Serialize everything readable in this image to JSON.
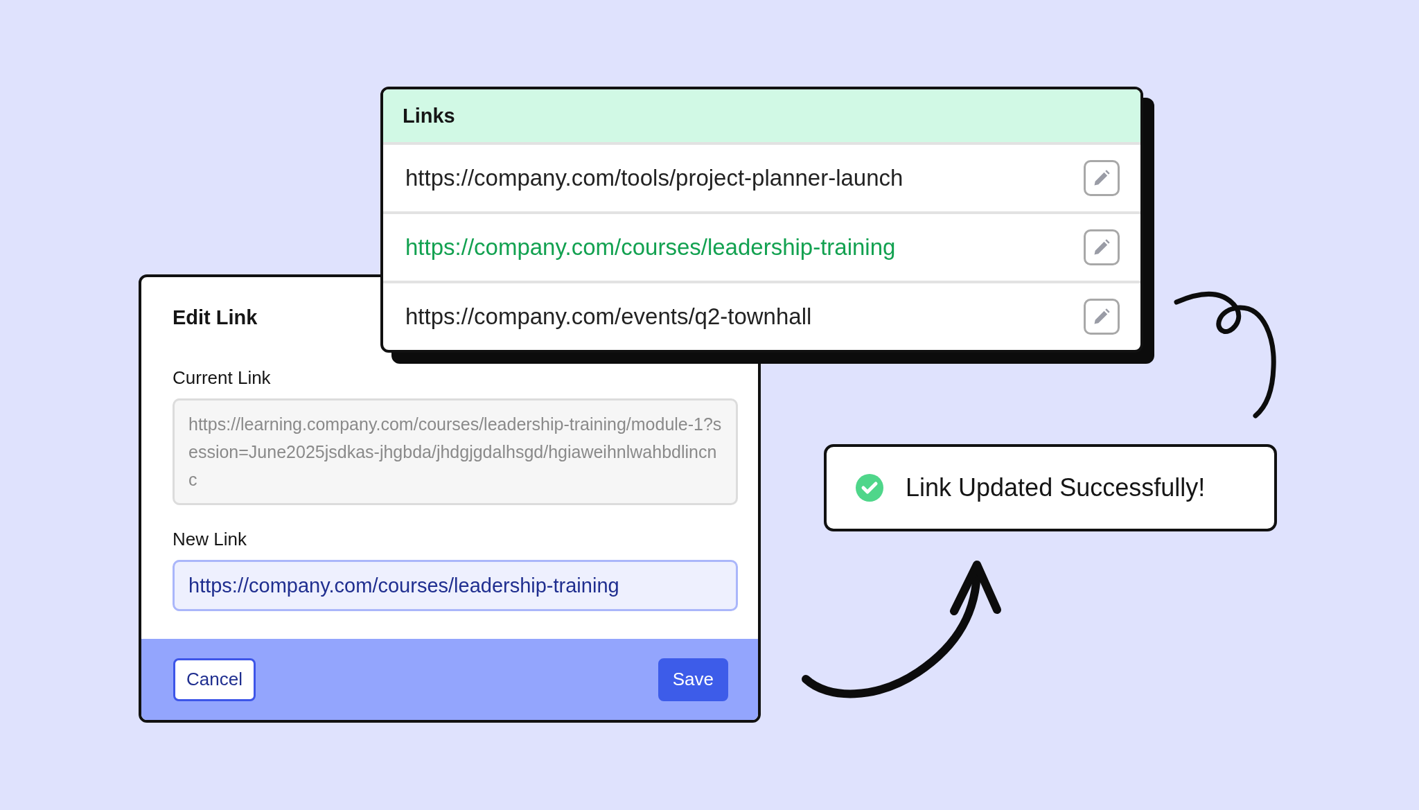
{
  "edit_dialog": {
    "title": "Edit Link",
    "current_link": {
      "label": "Current Link",
      "value": "https://learning.company.com/courses/leadership-training/module-1?session=June2025jsdkas-jhgbda/jhdgjgdalhsgd/hgiaweihnlwahbdlincnc",
      "disabled": true
    },
    "new_link": {
      "label": "New Link",
      "value": "https://company.com/courses/leadership-training"
    },
    "buttons": [
      {
        "label": "Cancel",
        "kind": "secondary"
      },
      {
        "label": "Save",
        "kind": "primary"
      }
    ]
  },
  "links_panel": {
    "title": "Links",
    "rows": [
      {
        "url": "https://company.com/tools/project-planner-launch",
        "selected": false
      },
      {
        "url": "https://company.com/courses/leadership-training",
        "selected": true
      },
      {
        "url": "https://company.com/events/q2-townhall",
        "selected": false
      }
    ]
  },
  "toast": {
    "message": "Link Updated Successfully!"
  }
}
